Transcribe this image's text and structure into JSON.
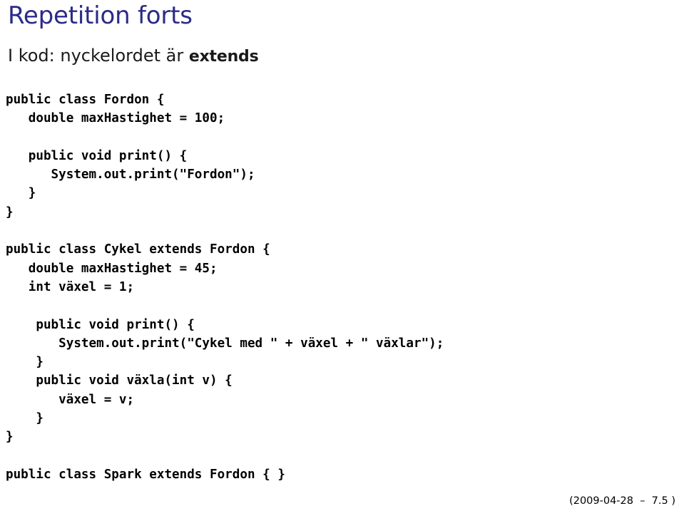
{
  "slide": {
    "title": "Repetition forts",
    "title_color": "#2b2b85",
    "subtitle_prefix": "I kod: nyckelordet är ",
    "subtitle_keyword": "extends",
    "background_color": "#ffffff",
    "text_color": "#000000"
  },
  "code_blocks": [
    {
      "name": "fordon-class",
      "lines": [
        "public class Fordon {",
        "   double maxHastighet = 100;",
        "",
        "   public void print() {",
        "      System.out.print(\"Fordon\");",
        "   }",
        "}"
      ]
    },
    {
      "name": "cykel-class",
      "lines": [
        "public class Cykel extends Fordon {",
        "   double maxHastighet = 45;",
        "   int växel = 1;",
        "",
        "    public void print() {",
        "       System.out.print(\"Cykel med \" + växel + \" växlar\");",
        "    }",
        "    public void växla(int v) {",
        "       växel = v;",
        "    }",
        "}"
      ]
    },
    {
      "name": "spark-class",
      "lines": [
        "public class Spark extends Fordon { }"
      ]
    }
  ],
  "footer": {
    "text": "(2009-04-28  –  7.5 )"
  }
}
